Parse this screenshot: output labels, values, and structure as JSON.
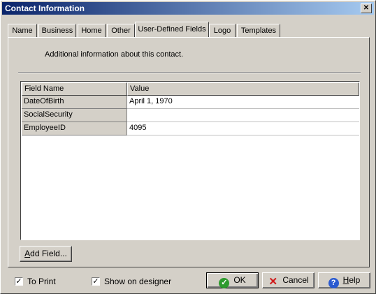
{
  "window": {
    "title": "Contact Information"
  },
  "tabs": [
    {
      "label": "Name"
    },
    {
      "label": "Business"
    },
    {
      "label": "Home"
    },
    {
      "label": "Other"
    },
    {
      "label": "User-Defined Fields"
    },
    {
      "label": "Logo"
    },
    {
      "label": "Templates"
    }
  ],
  "active_tab": "User-Defined Fields",
  "panel": {
    "description": "Additional information about this contact."
  },
  "grid": {
    "columns": [
      "Field Name",
      "Value"
    ],
    "rows": [
      {
        "name": "DateOfBirth",
        "value": "April 1, 1970"
      },
      {
        "name": "SocialSecurity",
        "value": ""
      },
      {
        "name": "EmployeeID",
        "value": "4095"
      }
    ]
  },
  "add_field_button": {
    "label_prefix": "",
    "mnemonic": "A",
    "label_rest": "dd Field..."
  },
  "footer": {
    "to_print": {
      "label": "To Print",
      "checked": true
    },
    "show_on_designer": {
      "label": "Show on designer",
      "checked": true
    },
    "ok": {
      "label": "OK",
      "icon": "check-circle-icon"
    },
    "cancel": {
      "label": "Cancel",
      "icon": "red-x-icon"
    },
    "help": {
      "mnemonic": "H",
      "label_rest": "elp",
      "icon": "help-question-icon"
    }
  },
  "colors": {
    "titlebar_start": "#0a246a",
    "titlebar_end": "#a6caf0",
    "face": "#d4d0c8",
    "ok_green": "#2e9b2e",
    "cancel_red": "#d01818",
    "help_blue": "#2a5ad0"
  }
}
